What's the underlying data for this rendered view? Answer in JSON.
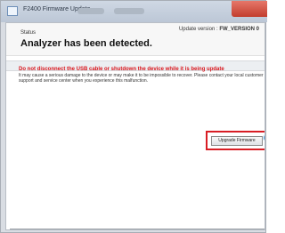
{
  "window": {
    "title": "F2400 Firmware Update"
  },
  "header": {
    "version_prefix": "Update version : ",
    "version_value": "FW_VERSION 0",
    "status_label": "Status",
    "status_message": "Analyzer has been detected."
  },
  "warning": {
    "title": "Do not disconnect the USB cable or shutdown the device while it is being update",
    "body": "It may cause a serious damage to the device or may make it to be impossible to recover. Please contact your local customer support and service center when you experience this malfunction."
  },
  "actions": {
    "upgrade_label": "Upgrade Firmware"
  },
  "colors": {
    "warning": "#d8141b",
    "highlight": "#d81d24",
    "help_icon": "#2f8fd8"
  }
}
